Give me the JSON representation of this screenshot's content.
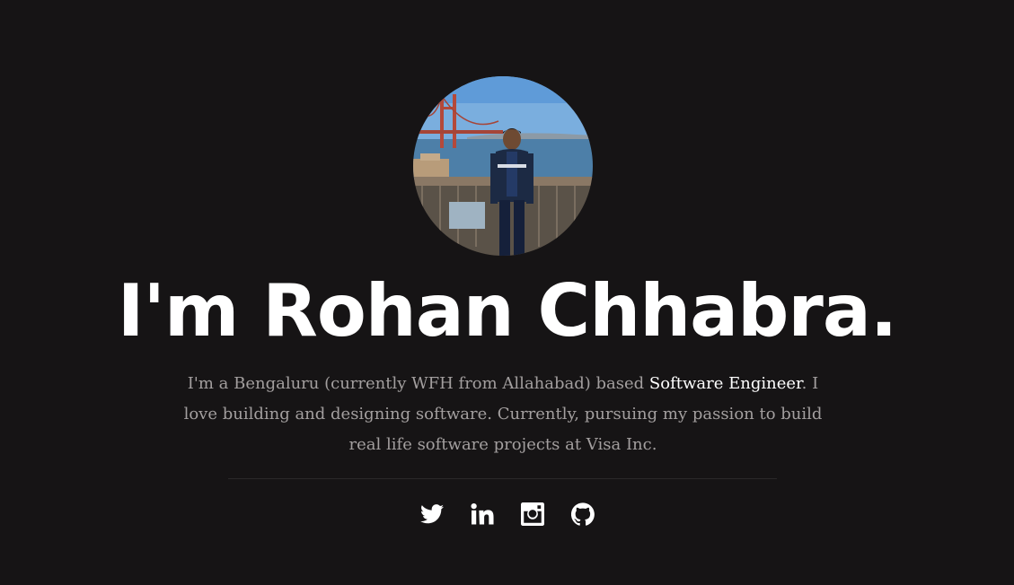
{
  "hero": {
    "title": "I'm Rohan Chhabra.",
    "intro": {
      "lead": "I'm a Bengaluru (currently WFH from Allahabad) based ",
      "highlight": "Software Engineer",
      "rest": ". I love building and designing software. Currently, pursuing my passion to build real life software projects at Visa Inc."
    }
  },
  "social": [
    {
      "icon": "twitter-icon"
    },
    {
      "icon": "linkedin-icon"
    },
    {
      "icon": "instagram-icon"
    },
    {
      "icon": "github-icon"
    }
  ],
  "colors": {
    "background": "#161415",
    "title": "#ffffff",
    "body_text": "#a39f9f",
    "highlight": "#ffffff",
    "divider": "#2b292a"
  }
}
